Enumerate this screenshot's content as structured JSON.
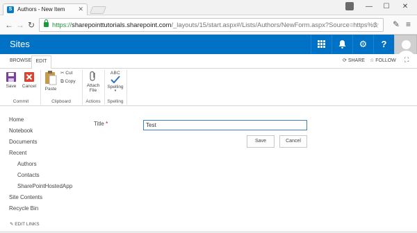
{
  "browser": {
    "tab_title": "Authors - New Item",
    "tab_close": "✕",
    "url_scheme": "https://",
    "url_host": "sharepointtutorials.sharepoint.com",
    "url_path": "/_layouts/15/start.aspx#/Lists/Authors/NewForm.aspx?Source=https%3",
    "window_controls": [
      "—",
      "☐",
      "✕"
    ]
  },
  "suitebar": {
    "title": "Sites",
    "buttons": [
      {
        "icon": "app-launcher-icon",
        "glyph": "⋮⋮⋮"
      },
      {
        "icon": "bell-icon",
        "glyph": "🔔"
      },
      {
        "icon": "gear-icon",
        "glyph": "⚙"
      },
      {
        "icon": "help-icon",
        "glyph": "?"
      }
    ]
  },
  "ribbon_tabs": {
    "browse": "BROWSE",
    "edit": "EDIT",
    "share": "SHARE",
    "follow": "FOLLOW"
  },
  "ribbon": {
    "save": "Save",
    "cancel": "Cancel",
    "paste": "Paste",
    "cut": "Cut",
    "copy": "Copy",
    "attach_line1": "Attach",
    "attach_line2": "File",
    "spelling": "Spelling",
    "abc": "ABC",
    "groups": {
      "commit": "Commit",
      "clipboard": "Clipboard",
      "actions": "Actions",
      "spelling": "Spelling"
    }
  },
  "left_nav": {
    "items": [
      "Home",
      "Notebook",
      "Documents",
      "Recent"
    ],
    "recent_items": [
      "Authors",
      "Contacts",
      "SharePointHostedApp"
    ],
    "bottom_items": [
      "Site Contents",
      "Recycle Bin"
    ],
    "edit_links": "EDIT LINKS"
  },
  "form": {
    "title_label": "Title",
    "required_mark": "*",
    "title_value": "Test",
    "save_label": "Save",
    "cancel_label": "Cancel"
  },
  "colors": {
    "suitebar": "#0072c6",
    "required": "#cc0000",
    "https_green": "#1a9b3a"
  }
}
